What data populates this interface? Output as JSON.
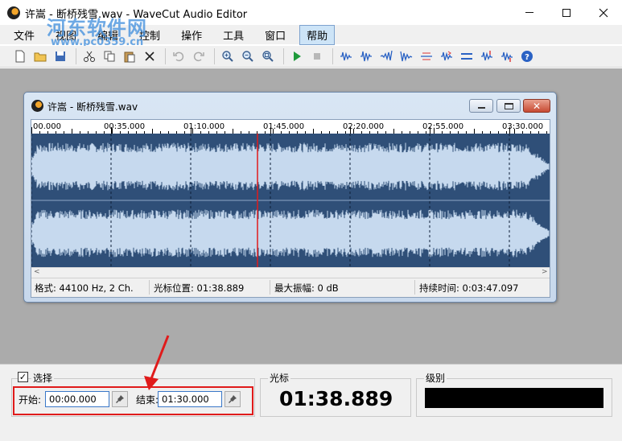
{
  "window": {
    "title": "许嵩 - 断桥残雪.wav - WaveCut Audio Editor"
  },
  "watermark": {
    "line1": "河东软件网",
    "line2": "www.pc0359.cn"
  },
  "menu": {
    "items": [
      {
        "label": "文件"
      },
      {
        "label": "视图"
      },
      {
        "label": "编辑"
      },
      {
        "label": "控制"
      },
      {
        "label": "操作"
      },
      {
        "label": "工具"
      },
      {
        "label": "窗口"
      },
      {
        "label": "帮助"
      }
    ],
    "active_index": 7
  },
  "document": {
    "title": "许嵩 - 断桥残雪.wav",
    "ruler_labels": [
      "00.000",
      "00:35.000",
      "01:10.000",
      "01:45.000",
      "02:20.000",
      "02:55.000",
      "03:30.000"
    ],
    "cursor_fraction": 0.437,
    "status": {
      "format": "格式: 44100 Hz, 2 Ch.",
      "cursor_pos": "光标位置: 01:38.889",
      "max_amp": "最大振幅: 0 dB",
      "duration": "持续时间: 0:03:47.097"
    }
  },
  "selection": {
    "checkbox_label": "选择",
    "checked": true,
    "start_label": "开始:",
    "start_value": "00:00.000",
    "end_label": "结束:",
    "end_value": "01:30.000"
  },
  "cursor_panel": {
    "label": "光标",
    "value": "01:38.889"
  },
  "level_panel": {
    "label": "级别"
  },
  "colors": {
    "wave_bg": "#2f4f78",
    "wave_fg": "#c6d9ee",
    "cursor_line": "#e01b1b",
    "annotation": "#e01b1b"
  }
}
